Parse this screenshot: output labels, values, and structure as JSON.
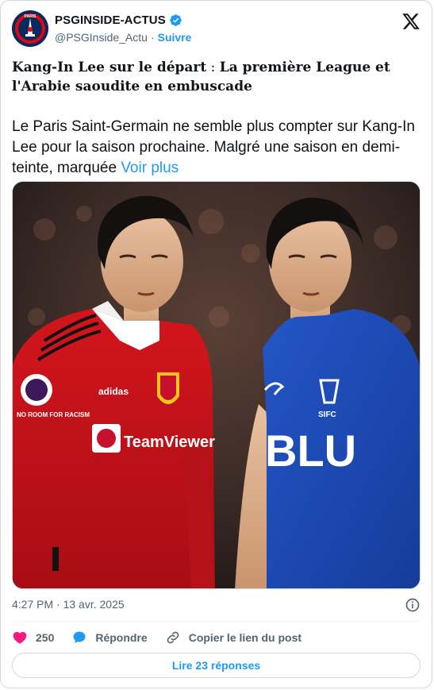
{
  "author": {
    "display_name": "PSGINSIDE-ACTUS",
    "handle": "@PSGInside_Actu",
    "separator": "·",
    "follow_label": "Suivre",
    "avatar_text": "PARIS"
  },
  "headline": {
    "part1": "Kang-In Lee sur le départ",
    "separator": " : ",
    "part2": "La première League et l'Arabie saoudite en embuscade"
  },
  "body": {
    "text": "Le Paris Saint-Germain ne semble plus compter sur Kang-In Lee pour la saison prochaine. Malgré une saison en demi-teinte, marquée ",
    "more_label": "Voir plus"
  },
  "media": {
    "left_shirt_sponsor": "TeamViewer",
    "left_shirt_brand": "adidas",
    "left_sleeve_text": "NO ROOM FOR RACISM",
    "right_shirt_sponsor": "BLU",
    "right_shirt_badge": "SIFC"
  },
  "meta": {
    "time": "4:27 PM",
    "separator": "·",
    "date": "13 avr. 2025"
  },
  "actions": {
    "like_count": "250",
    "reply_label": "Répondre",
    "copy_link_label": "Copier le lien du post"
  },
  "read_replies_label": "Lire 23 réponses",
  "colors": {
    "accent": "#1d9bf0",
    "like": "#f91880",
    "text": "#0f1419",
    "secondary": "#536471"
  }
}
